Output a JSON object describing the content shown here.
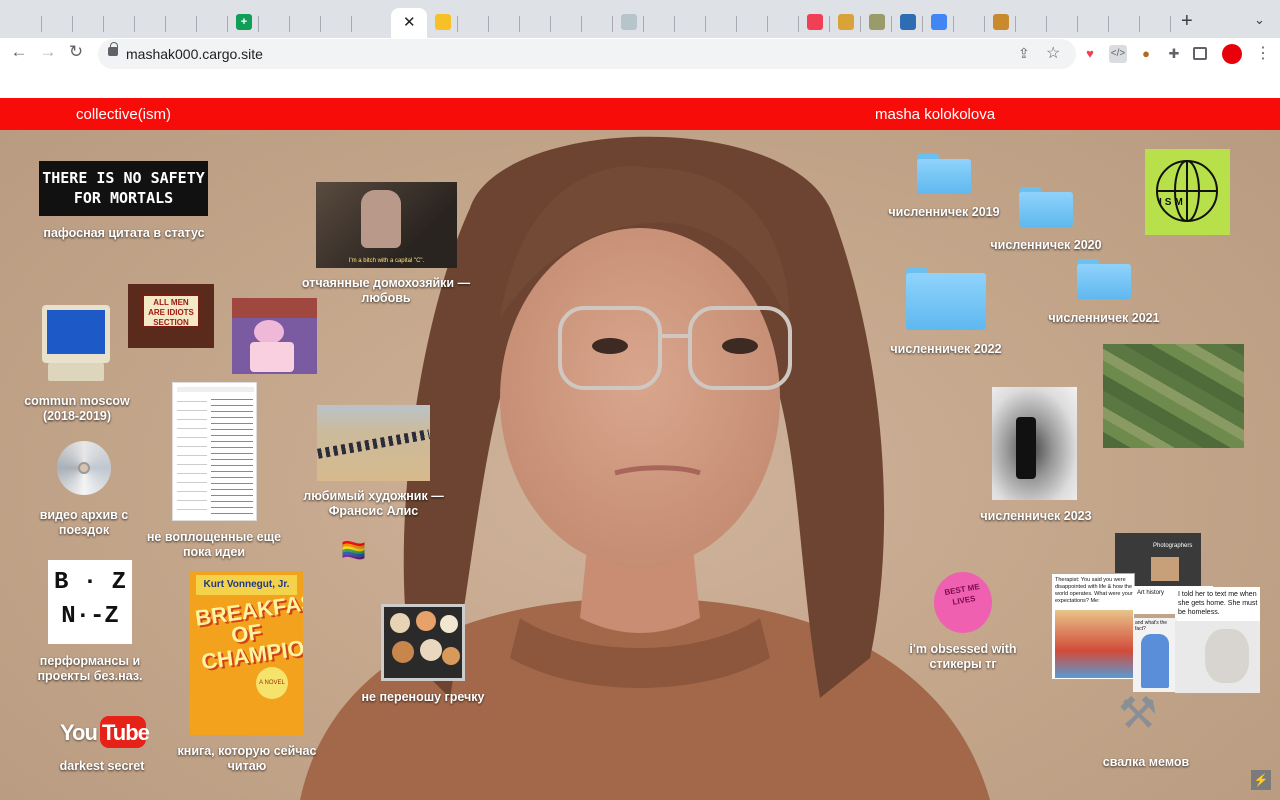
{
  "browser": {
    "url": "mashak000.cargo.site",
    "active_tab_close": "✕",
    "new_tab": "+",
    "tab_menu": "⌄",
    "back": "←",
    "forward": "→",
    "reload": "↻",
    "share": "⇪",
    "star": "☆",
    "kebab": "⋮"
  },
  "site": {
    "left_link": "collective(ism)",
    "right_link": "masha kolokolova",
    "accent_color": "#f70c0a"
  },
  "desktop": {
    "quote_image_text": "THERE IS NO SAFETY FOR MORTALS",
    "quote_label": "пафосная цитата в статус",
    "housewives_subtitle": "I'm a bitch with a capital \"C\".",
    "housewives_label": "отчаянные домохозяйки — любовь",
    "commun_label": "commun moscow (2018-2019)",
    "sign_text": "ALL MEN ARE IDIOTS SECTION",
    "cd_label": "видео архив с поездок",
    "ideas_label": "не воплощенные еще пока идеи",
    "alys_label": "любимый художник — Франсис Алис",
    "flag_emoji": "🏳️‍🌈",
    "bz_text_1": "B · Z",
    "bz_text_2": "N·-Z",
    "bz_label": "перформансы и проекты без.наз.",
    "book_author": "Kurt Vonnegut, Jr.",
    "book_title": "BREAKFAST OF CHAMPIONS",
    "book_badge": "A NOVEL",
    "book_label": "книга, которую сейчас читаю",
    "food_label": "не переношу гречку",
    "youtube_text": "YouTube",
    "youtube_label": "darkest secret",
    "folder_2019": "численничек 2019",
    "folder_2020": "численничек 2020",
    "folder_2021": "численничек 2021",
    "folder_2022": "численничек 2022",
    "folder_2023": "численничек 2023",
    "ism_text": "ISM",
    "stickers_label": "i'm obsessed with стикеры тг",
    "cake_text": "BEST ME LIVES",
    "meme_top_label": "Photographers",
    "meme_top_sub": "Art history",
    "meme_therapist": "Therapist: You said you were disappointed with life & how the world operates. What were your expectations? Me:",
    "meme_told": "I told her to text me when she gets home. She must be homeless.",
    "meme_what": "and what's the fact?",
    "memes_label": "свалка мемов"
  }
}
